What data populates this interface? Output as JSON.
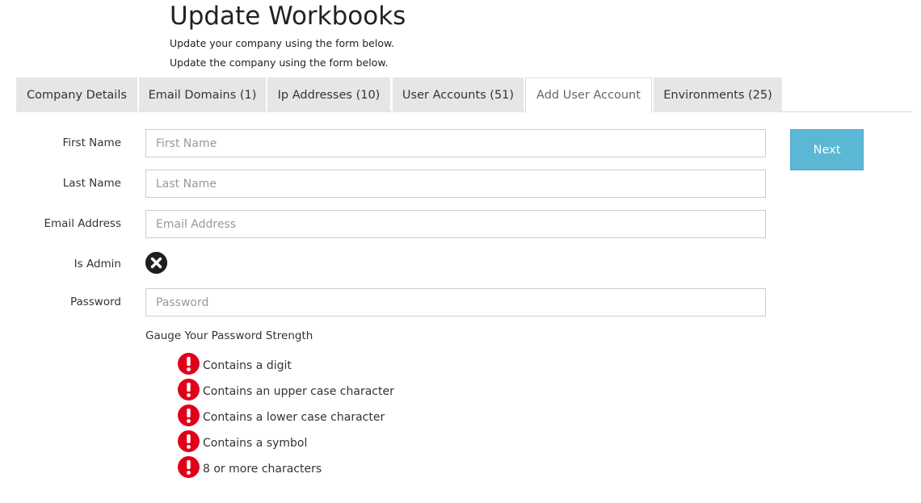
{
  "header": {
    "title": "Update Workbooks",
    "subtitle_1": "Update your company using the form below.",
    "subtitle_2": "Update the company using the form below."
  },
  "tabs": [
    {
      "label": "Company Details",
      "active": false
    },
    {
      "label": "Email Domains (1)",
      "active": false
    },
    {
      "label": "Ip Addresses (10)",
      "active": false
    },
    {
      "label": "User Accounts (51)",
      "active": false
    },
    {
      "label": "Add User Account",
      "active": true
    },
    {
      "label": "Environments (25)",
      "active": false
    }
  ],
  "form": {
    "first_name": {
      "label": "First Name",
      "value": "",
      "placeholder": "First Name"
    },
    "last_name": {
      "label": "Last Name",
      "value": "",
      "placeholder": "Last Name"
    },
    "email": {
      "label": "Email Address",
      "value": "",
      "placeholder": "Email Address"
    },
    "is_admin": {
      "label": "Is Admin",
      "value": false,
      "icon": "x-circle-icon"
    },
    "password": {
      "label": "Password",
      "value": "",
      "placeholder": "Password"
    }
  },
  "next_label": "Next",
  "password_strength": {
    "title": "Gauge Your Password Strength",
    "rules": [
      {
        "text": "Contains a digit",
        "met": false,
        "icon": "exclamation-circle-icon"
      },
      {
        "text": "Contains an upper case character",
        "met": false,
        "icon": "exclamation-circle-icon"
      },
      {
        "text": "Contains a lower case character",
        "met": false,
        "icon": "exclamation-circle-icon"
      },
      {
        "text": "Contains a symbol",
        "met": false,
        "icon": "exclamation-circle-icon"
      },
      {
        "text": "8 or more characters",
        "met": false,
        "icon": "exclamation-circle-icon"
      }
    ]
  },
  "colors": {
    "accent": "#5bb8d5",
    "warning": "#e0001a",
    "tab_bg": "#e6e6e6"
  }
}
